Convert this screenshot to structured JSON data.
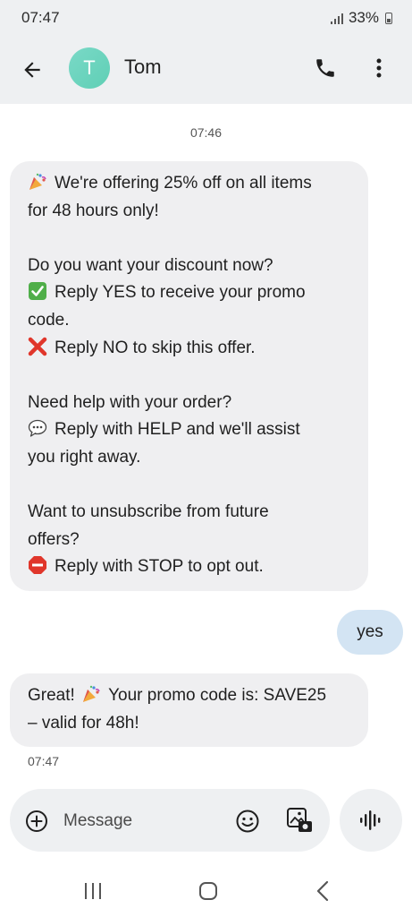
{
  "status_bar": {
    "time": "07:47",
    "battery": "33%"
  },
  "header": {
    "avatar_letter": "T",
    "contact_name": "Tom"
  },
  "conversation": {
    "timestamp_top": "07:46",
    "incoming_1": {
      "lines": [
        {
          "emoji": "party-popper-icon",
          "text": "We're offering 25% off on all items"
        },
        {
          "text": "for 48 hours only!"
        },
        {
          "text": ""
        },
        {
          "text": "Do you want your discount now?"
        },
        {
          "emoji": "check-mark-icon",
          "text": "Reply YES to receive your promo"
        },
        {
          "text": "code."
        },
        {
          "emoji": "cross-mark-icon",
          "text": "Reply NO to skip this offer."
        },
        {
          "text": ""
        },
        {
          "text": "Need help with your order?"
        },
        {
          "emoji": "speech-bubble-icon",
          "text": "Reply with HELP and we'll assist"
        },
        {
          "text": "you right away."
        },
        {
          "text": ""
        },
        {
          "text": "Want to unsubscribe from future"
        },
        {
          "text": "offers?"
        },
        {
          "emoji": "stop-sign-icon",
          "text": "Reply with STOP to opt out."
        }
      ]
    },
    "outgoing_1": {
      "text": "yes"
    },
    "incoming_2": {
      "line1_before": "Great!",
      "line1_emoji": "party-popper-icon",
      "line1_after": "Your promo code is: SAVE25",
      "line2": "– valid for 48h!"
    },
    "timestamp_bottom": "07:47"
  },
  "composer": {
    "placeholder": "Message"
  },
  "colors": {
    "header_bg": "#eef0f2",
    "incoming_bubble": "#efeff1",
    "outgoing_bubble": "#d3e4f3",
    "avatar": "#6ed4be"
  }
}
